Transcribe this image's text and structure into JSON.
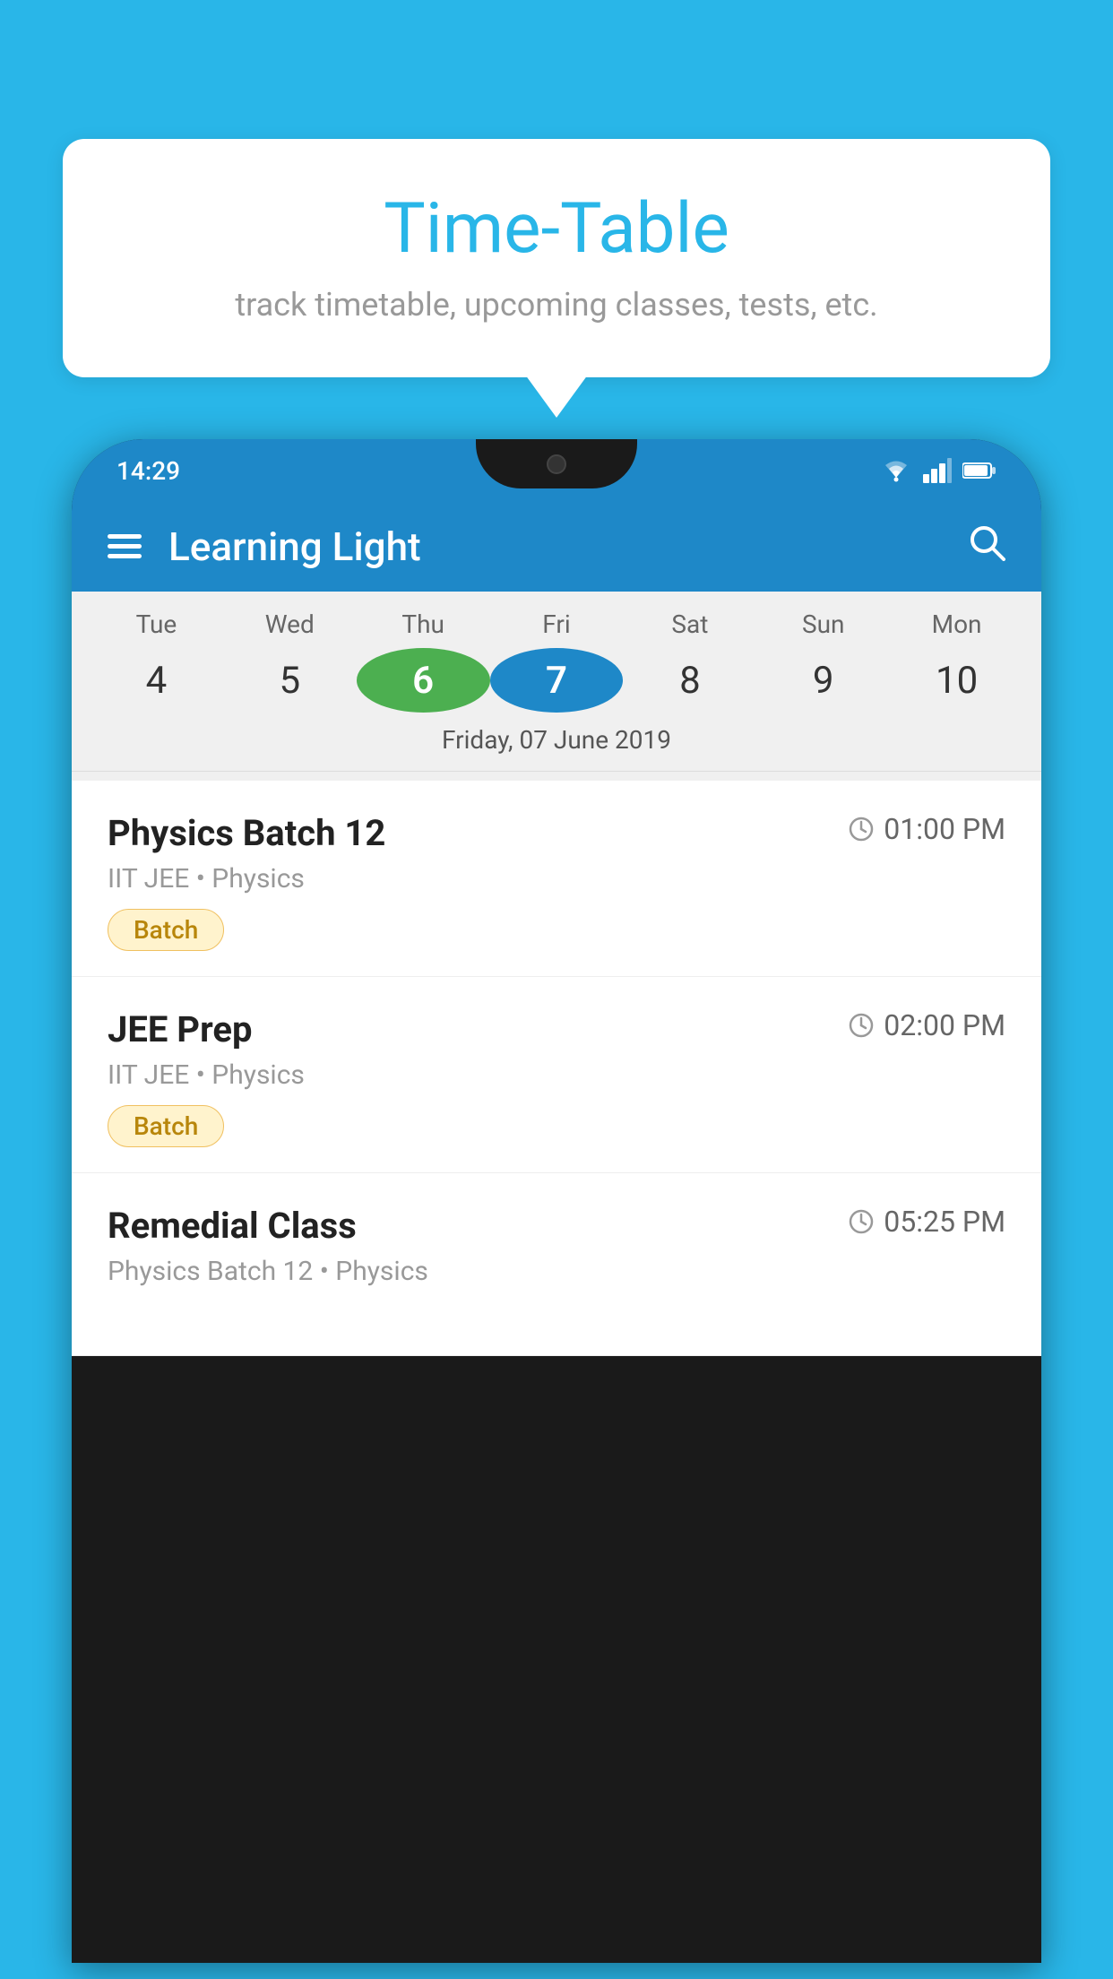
{
  "background_color": "#29B6E8",
  "speech_bubble": {
    "title": "Time-Table",
    "subtitle": "track timetable, upcoming classes, tests, etc."
  },
  "phone": {
    "status_bar": {
      "time": "14:29",
      "icons": [
        "wifi",
        "signal",
        "battery"
      ]
    },
    "app_bar": {
      "title": "Learning Light",
      "has_menu": true,
      "has_search": true
    },
    "calendar": {
      "day_headers": [
        "Tue",
        "Wed",
        "Thu",
        "Fri",
        "Sat",
        "Sun",
        "Mon"
      ],
      "day_numbers": [
        "4",
        "5",
        "6",
        "7",
        "8",
        "9",
        "10"
      ],
      "today_index": 2,
      "selected_index": 3,
      "selected_label": "Friday, 07 June 2019"
    },
    "classes": [
      {
        "name": "Physics Batch 12",
        "time": "01:00 PM",
        "meta": "IIT JEE • Physics",
        "badge": "Batch"
      },
      {
        "name": "JEE Prep",
        "time": "02:00 PM",
        "meta": "IIT JEE • Physics",
        "badge": "Batch"
      },
      {
        "name": "Remedial Class",
        "time": "05:25 PM",
        "meta": "Physics Batch 12 • Physics",
        "badge": null
      }
    ]
  }
}
